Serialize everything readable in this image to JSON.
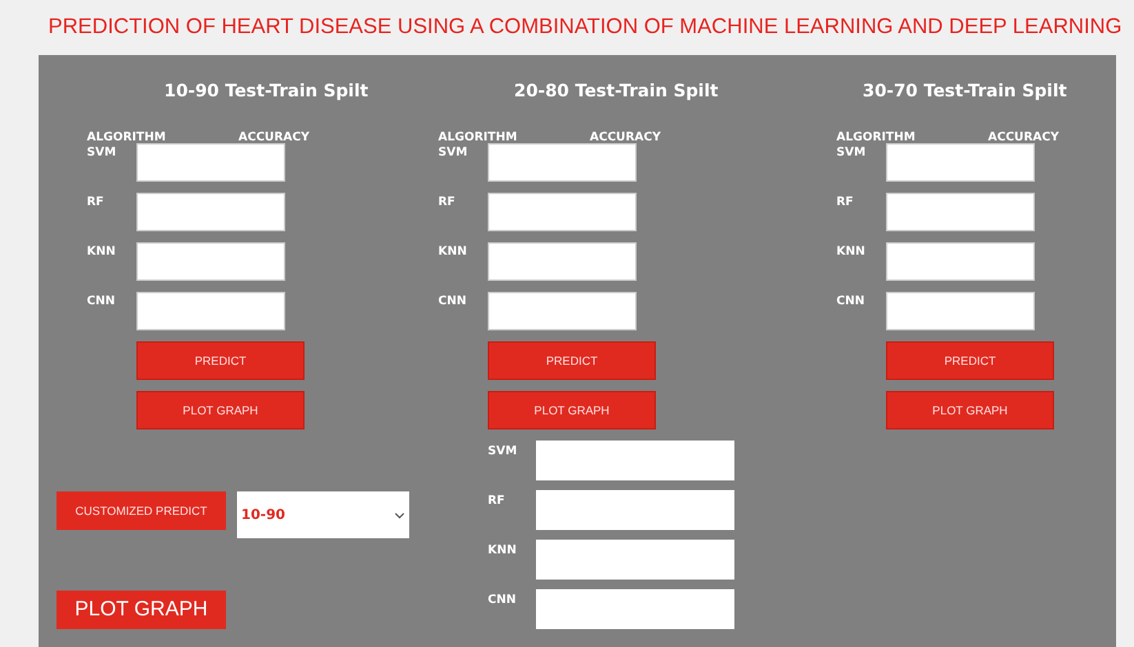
{
  "title": "PREDICTION OF HEART DISEASE USING A COMBINATION OF MACHINE LEARNING AND DEEP LEARNING",
  "splits": [
    {
      "heading": "10-90 Test-Train Spilt",
      "column_headers": [
        "ALGORITHM",
        "ACCURACY"
      ],
      "rows": [
        {
          "label": "SVM"
        },
        {
          "label": "RF"
        },
        {
          "label": "KNN"
        },
        {
          "label": "CNN"
        }
      ],
      "buttons": [
        "PREDICT",
        "PLOT GRAPH"
      ]
    },
    {
      "heading": "20-80 Test-Train Spilt",
      "column_headers": [
        "ALGORITHM",
        "ACCURACY"
      ],
      "rows": [
        {
          "label": "SVM"
        },
        {
          "label": "RF"
        },
        {
          "label": "KNN"
        },
        {
          "label": "CNN"
        }
      ],
      "buttons": [
        "PREDICT",
        "PLOT GRAPH"
      ]
    },
    {
      "heading": "30-70 Test-Train Spilt",
      "column_headers": [
        "ALGORITHM",
        "ACCURACY"
      ],
      "rows": [
        {
          "label": "SVM"
        },
        {
          "label": "RF"
        },
        {
          "label": "KNN"
        },
        {
          "label": "CNN"
        }
      ],
      "buttons": [
        "PREDICT",
        "PLOT GRAPH"
      ]
    }
  ],
  "customized": {
    "button": "CUSTOMIZED PREDICT",
    "select": {
      "value": "10-90"
    },
    "rows": [
      {
        "label": "SVM"
      },
      {
        "label": "RF"
      },
      {
        "label": "KNN"
      },
      {
        "label": "CNN"
      }
    ]
  },
  "plot_button": "PLOT GRAPH"
}
